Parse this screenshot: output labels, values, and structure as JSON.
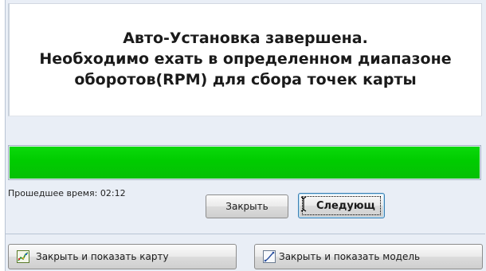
{
  "dialog": {
    "heading": {
      "line1": "Авто-Установка завершена.",
      "line2": "Необходимо ехать в определенном диапазоне",
      "line3": "оборотов(RPM) для сбора точек карты"
    },
    "progress": {
      "fraction": 1.0
    },
    "elapsed_label": "Прошедшее время: 02:12",
    "buttons": {
      "close": "Закрыть",
      "next": "Следующ",
      "close_show_map": "Закрыть и показать карту",
      "close_show_model": "Закрыть и показать модель"
    },
    "icons": {
      "map": "map-chart-icon",
      "model": "model-curve-icon"
    },
    "colors": {
      "progress": "#00cc00",
      "focus_border": "#3c7fb1"
    }
  }
}
